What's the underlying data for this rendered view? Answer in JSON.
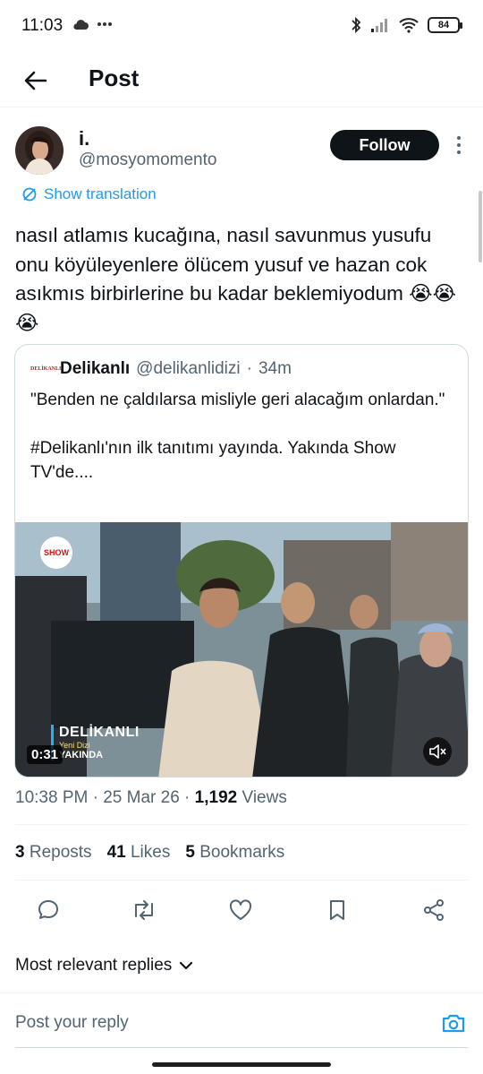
{
  "status_bar": {
    "time": "11:03",
    "left_icons": [
      "cloud-icon",
      "more-dots-icon"
    ],
    "right_icons": [
      "bluetooth-icon",
      "signal-icon",
      "wifi-icon",
      "battery-icon"
    ],
    "battery": "84"
  },
  "header": {
    "title": "Post",
    "back_icon": "arrow-left-icon"
  },
  "author": {
    "display_name": "i.",
    "handle": "@mosyomomento",
    "follow_label": "Follow"
  },
  "translation": {
    "label": "Show translation",
    "icon": "translate-icon"
  },
  "tweet": {
    "text": "nasıl atlamıs kucağına, nasıl savunmus yusufu onu köyüleyenlere ölücem yusuf ve hazan cok asıkmıs birbirlerine bu kadar beklemiyodum 😭😭😭"
  },
  "quote": {
    "logo_text": "DELİKANLI",
    "name": "Delikanlı",
    "handle": "@delikanlidizi",
    "separator": "·",
    "time": "34m",
    "text": "\"Benden ne çaldılarsa misliyle geri alacağım onlardan.\"\n\n#Delikanlı'nın ilk tanıtımı yayında. Yakında Show TV'de....",
    "video": {
      "channel_logo": "SHOW",
      "brand_title": "DELİKANLI",
      "brand_sub": "Yeni Dizi",
      "brand_soon": "YAKINDA",
      "duration": "0:31",
      "mute_icon": "volume-muted-icon"
    }
  },
  "meta": {
    "time": "10:38 PM",
    "dot1": "·",
    "date": "25 Mar 26",
    "dot2": "·",
    "views_count": "1,192",
    "views_label": "Views"
  },
  "stats": {
    "reposts_count": "3",
    "reposts_label": "Reposts",
    "likes_count": "41",
    "likes_label": "Likes",
    "bookmarks_count": "5",
    "bookmarks_label": "Bookmarks"
  },
  "actions": [
    "reply-icon",
    "repost-icon",
    "like-icon",
    "bookmark-icon",
    "share-icon"
  ],
  "replies": {
    "sort_label": "Most relevant replies"
  },
  "reply_bar": {
    "placeholder": "Post your reply",
    "camera_icon": "camera-icon"
  },
  "colors": {
    "accent": "#1d9bf0",
    "text_primary": "#0f1419",
    "text_secondary": "#536471",
    "border": "#cfd9de"
  }
}
